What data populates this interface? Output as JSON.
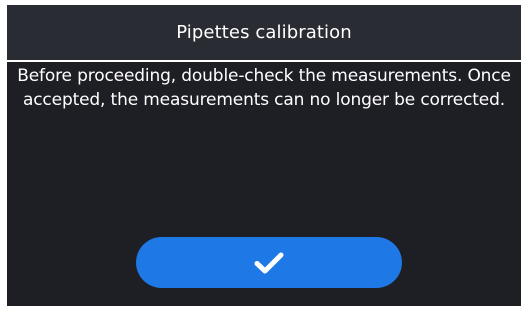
{
  "dialog": {
    "title": "Pipettes calibration",
    "message_line_1": "Before proceeding, double-check the measurements. Once",
    "message_line_2": "accepted, the measurements can no longer be corrected.",
    "confirm_icon": "checkmark-icon"
  },
  "colors": {
    "title_bar": "#2a2c33",
    "body_background": "#1e1f25",
    "button_accent": "#1e78e6",
    "text": "#ffffff"
  }
}
